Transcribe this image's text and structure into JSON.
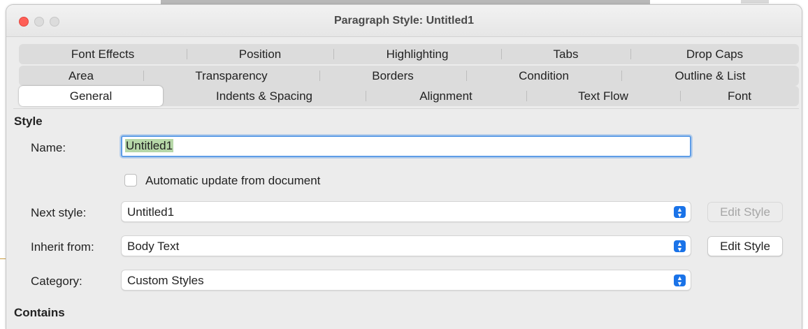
{
  "window": {
    "title": "Paragraph Style: Untitled1"
  },
  "tabs": {
    "row1": [
      "Font Effects",
      "Position",
      "Highlighting",
      "Tabs",
      "Drop Caps"
    ],
    "row2": [
      "Area",
      "Transparency",
      "Borders",
      "Condition",
      "Outline & List"
    ],
    "row3": [
      "General",
      "Indents & Spacing",
      "Alignment",
      "Text Flow",
      "Font"
    ],
    "active": "General"
  },
  "style_section": {
    "heading": "Style",
    "name_label": "Name:",
    "name_value": "Untitled1",
    "auto_update_label": "Automatic update from document",
    "auto_update_checked": false,
    "next_style_label": "Next style:",
    "next_style_value": "Untitled1",
    "inherit_from_label": "Inherit from:",
    "inherit_from_value": "Body Text",
    "category_label": "Category:",
    "category_value": "Custom Styles",
    "edit_style_label": "Edit Style"
  },
  "contains_section": {
    "heading": "Contains"
  },
  "colors": {
    "focus_ring": "#5e9de7",
    "select_chevron": "#1a73e8",
    "close_button": "#fe5f57"
  },
  "icons": {
    "select_chevron": "chevron-up-down-icon"
  }
}
